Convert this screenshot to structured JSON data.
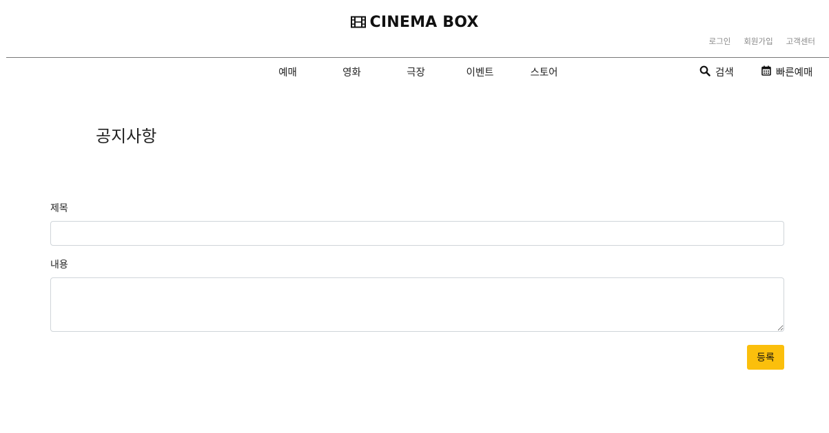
{
  "header": {
    "logo_text": "CINEMA BOX",
    "logo_icon": "film-icon",
    "util_links": [
      "로그인",
      "회원가입",
      "고객센터"
    ]
  },
  "nav": {
    "items": [
      "예매",
      "영화",
      "극장",
      "이벤트",
      "스토어"
    ],
    "search_label": "검색",
    "search_icon": "search-icon",
    "quick_label": "빠른예매",
    "quick_icon": "calendar-icon"
  },
  "page": {
    "title": "공지사항"
  },
  "form": {
    "title_label": "제목",
    "title_value": "",
    "content_label": "내용",
    "content_value": "",
    "submit_label": "등록",
    "submit_color": "#fbbf0c"
  }
}
